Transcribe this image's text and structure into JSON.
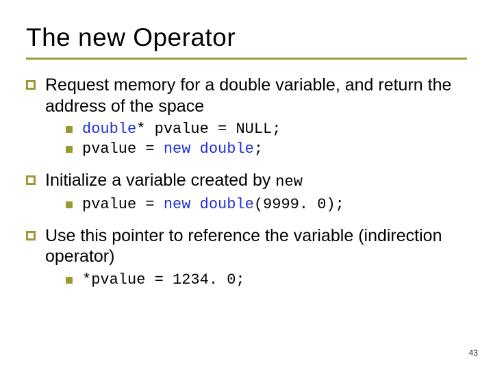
{
  "title": "The new Operator",
  "points": [
    {
      "text": "Request memory for a double variable, and return the address of the space",
      "sub": [
        {
          "parts": [
            "double",
            "* pvalue = NULL;"
          ]
        },
        {
          "parts": [
            "pvalue = ",
            "new",
            " ",
            "double",
            ";"
          ]
        }
      ]
    },
    {
      "text_parts": [
        "Initialize a variable created by ",
        "new"
      ],
      "sub": [
        {
          "parts": [
            "pvalue = ",
            "new",
            " ",
            "double",
            "(9999. 0);"
          ]
        }
      ]
    },
    {
      "text": "Use this pointer to reference the variable (indirection operator)",
      "sub": [
        {
          "parts": [
            "*pvalue = 1234. 0;"
          ]
        }
      ]
    }
  ],
  "page_number": "43"
}
